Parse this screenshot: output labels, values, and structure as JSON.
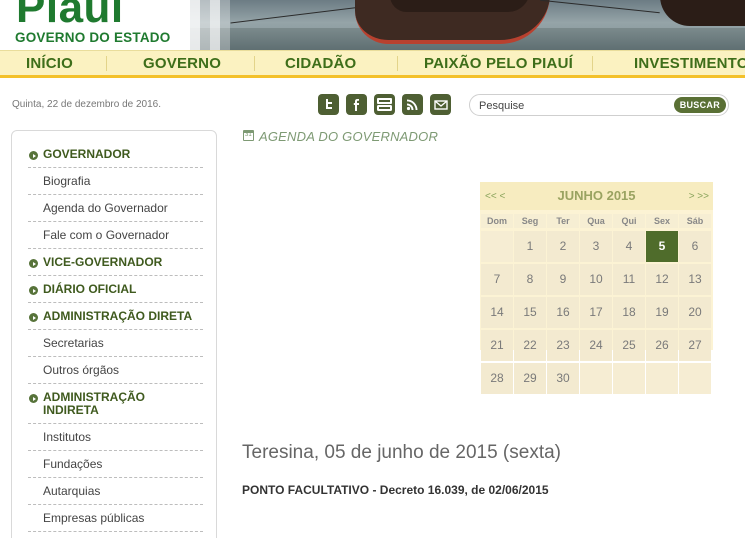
{
  "header": {
    "logo_word": "Piauí",
    "logo_sub": "GOVERNO DO ESTADO"
  },
  "nav": [
    "INÍCIO",
    "GOVERNO",
    "CIDADÃO",
    "PAIXÃO PELO PIAUÍ",
    "INVESTIMENTO"
  ],
  "date_text": "Quinta, 22 de dezembro de 2016.",
  "social_icons": [
    "twitter-icon",
    "facebook-icon",
    "youtube-icon",
    "rss-icon",
    "email-icon"
  ],
  "search": {
    "placeholder": "Pesquise",
    "button_label": "BUSCAR"
  },
  "sidebar": {
    "items": [
      {
        "label": "GOVERNADOR",
        "type": "head"
      },
      {
        "label": "Biografia",
        "type": "sub"
      },
      {
        "label": "Agenda do Governador",
        "type": "sub"
      },
      {
        "label": "Fale com o Governador",
        "type": "sub"
      },
      {
        "label": "VICE-GOVERNADOR",
        "type": "head"
      },
      {
        "label": "DIÁRIO OFICIAL",
        "type": "head"
      },
      {
        "label": "ADMINISTRAÇÃO DIRETA",
        "type": "head"
      },
      {
        "label": "Secretarias",
        "type": "sub"
      },
      {
        "label": "Outros órgãos",
        "type": "sub"
      },
      {
        "label": "ADMINISTRAÇÃO\nINDIRETA",
        "type": "head"
      },
      {
        "label": "Institutos",
        "type": "sub"
      },
      {
        "label": "Fundações",
        "type": "sub"
      },
      {
        "label": "Autarquias",
        "type": "sub"
      },
      {
        "label": "Empresas públicas",
        "type": "sub"
      }
    ]
  },
  "content": {
    "section_title": "AGENDA DO GOVERNADOR",
    "calendar": {
      "prev": "<< <",
      "next": "> >>",
      "month_label": "JUNHO 2015",
      "weekdays": [
        "Dom",
        "Seg",
        "Ter",
        "Qua",
        "Qui",
        "Sex",
        "Sáb"
      ],
      "first_weekday_index": 1,
      "days_in_month": 30,
      "selected_day": 5
    },
    "event_heading": "Teresina, 05 de junho de 2015 (sexta)",
    "event_text": "PONTO FACULTATIVO - Decreto 16.039, de 02/06/2015"
  }
}
